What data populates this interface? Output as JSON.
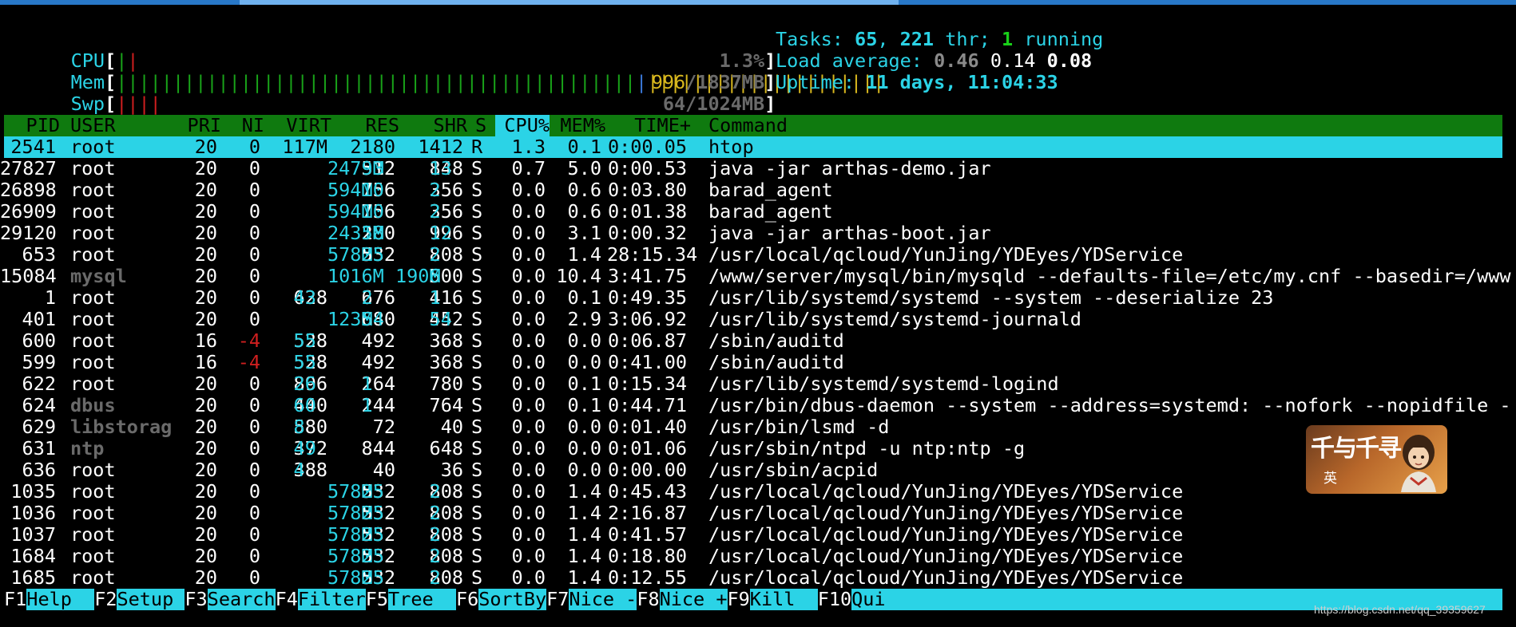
{
  "meters": {
    "cpu": {
      "label": "CPU",
      "open": "[",
      "close": "]",
      "bars": "||",
      "value": "1.3%",
      "fill_fraction": 0.013
    },
    "mem": {
      "label": "Mem",
      "open": "[",
      "close": "]",
      "bars_used": "||||||||||||||||||||||||||||||||||||||||||||||",
      "bars_buffers": "|",
      "bars_cache": "|||||||||||||||||||||",
      "value_used": "996",
      "value_rest": "/1837MB",
      "fill_fraction": 0.542
    },
    "swp": {
      "label": "Swp",
      "open": "[",
      "close": "]",
      "bars": "||||",
      "value": "64/1024MB",
      "fill_fraction": 0.0625
    }
  },
  "sysinfo": {
    "tasks_label": "Tasks: ",
    "tasks_value": "65",
    "tasks_sep": ", ",
    "threads_value": "221",
    "threads_label": " thr; ",
    "running_value": "1",
    "running_label": " running",
    "load_label": "Load average: ",
    "load_1": "0.46",
    "load_5": "0.14",
    "load_15": "0.08",
    "uptime_label": "Uptime: ",
    "uptime_value": "11 days, 11:04:33"
  },
  "columns": {
    "pid": "PID",
    "user": "USER",
    "pri": "PRI",
    "ni": "NI",
    "virt": "VIRT",
    "res": "RES",
    "shr": "SHR",
    "s": "S",
    "cpu": "CPU%",
    "mem": "MEM%",
    "time": "TIME+",
    "command": "Command"
  },
  "processes": [
    {
      "pid": "2541",
      "user": "root",
      "pri": "20",
      "ni": "0",
      "virt": "117M",
      "res": "2180",
      "shr": "1412",
      "s": "R",
      "cpu": "1.3",
      "mem": "0.1",
      "time": "0:00.05",
      "command": "htop"
    },
    {
      "pid": "27827",
      "user": "root",
      "pri": "20",
      "ni": "0",
      "virt": "2473M",
      "res": "93512",
      "shr": "13848",
      "s": "S",
      "cpu": "0.7",
      "mem": "5.0",
      "time": "0:00.53",
      "command": "java -jar arthas-demo.jar"
    },
    {
      "pid": "26898",
      "user": "root",
      "pri": "20",
      "ni": "0",
      "virt": "594M",
      "res": "10756",
      "shr": "2356",
      "s": "S",
      "cpu": "0.0",
      "mem": "0.6",
      "time": "0:03.80",
      "command": "barad_agent"
    },
    {
      "pid": "26909",
      "user": "root",
      "pri": "20",
      "ni": "0",
      "virt": "594M",
      "res": "10756",
      "shr": "2356",
      "s": "S",
      "cpu": "0.0",
      "mem": "0.6",
      "time": "0:01.38",
      "command": "barad_agent"
    },
    {
      "pid": "29120",
      "user": "root",
      "pri": "20",
      "ni": "0",
      "virt": "2431M",
      "res": "58280",
      "shr": "12996",
      "s": "S",
      "cpu": "0.0",
      "mem": "3.1",
      "time": "0:00.32",
      "command": "java -jar arthas-boot.jar"
    },
    {
      "pid": "653",
      "user": "root",
      "pri": "20",
      "ni": "0",
      "virt": "578M",
      "res": "25532",
      "shr": "2808",
      "s": "S",
      "cpu": "0.0",
      "mem": "1.4",
      "time": "28:15.34",
      "command": "/usr/local/qcloud/YunJing/YDEyes/YDService"
    },
    {
      "pid": "15084",
      "user": "mysql",
      "pri": "20",
      "ni": "0",
      "virt": "1016M",
      "res": "190M",
      "shr": "6500",
      "s": "S",
      "cpu": "0.0",
      "mem": "10.4",
      "time": "3:41.75",
      "command": "/www/server/mysql/bin/mysqld --defaults-file=/etc/my.cnf --basedir=/www"
    },
    {
      "pid": "1",
      "user": "root",
      "pri": "20",
      "ni": "0",
      "virt": "43628",
      "res": "2676",
      "shr": "1416",
      "s": "S",
      "cpu": "0.0",
      "mem": "0.1",
      "time": "0:49.35",
      "command": "/usr/lib/systemd/systemd --system --deserialize 23"
    },
    {
      "pid": "401",
      "user": "root",
      "pri": "20",
      "ni": "0",
      "virt": "123M",
      "res": "54680",
      "shr": "54452",
      "s": "S",
      "cpu": "0.0",
      "mem": "2.9",
      "time": "3:06.92",
      "command": "/usr/lib/systemd/systemd-journald"
    },
    {
      "pid": "600",
      "user": "root",
      "pri": "16",
      "ni": "-4",
      "virt": "55528",
      "res": "492",
      "shr": "368",
      "s": "S",
      "cpu": "0.0",
      "mem": "0.0",
      "time": "0:06.87",
      "command": "/sbin/auditd"
    },
    {
      "pid": "599",
      "user": "root",
      "pri": "16",
      "ni": "-4",
      "virt": "55528",
      "res": "492",
      "shr": "368",
      "s": "S",
      "cpu": "0.0",
      "mem": "0.0",
      "time": "0:41.00",
      "command": "/sbin/auditd"
    },
    {
      "pid": "622",
      "user": "root",
      "pri": "20",
      "ni": "0",
      "virt": "26896",
      "res": "1264",
      "shr": "780",
      "s": "S",
      "cpu": "0.0",
      "mem": "0.1",
      "time": "0:15.34",
      "command": "/usr/lib/systemd/systemd-logind"
    },
    {
      "pid": "624",
      "user": "dbus",
      "pri": "20",
      "ni": "0",
      "virt": "60440",
      "res": "1244",
      "shr": "764",
      "s": "S",
      "cpu": "0.0",
      "mem": "0.1",
      "time": "0:44.71",
      "command": "/usr/bin/dbus-daemon --system --address=systemd: --nofork --nopidfile -"
    },
    {
      "pid": "629",
      "user": "libstorag",
      "pri": "20",
      "ni": "0",
      "virt": "8580",
      "res": "72",
      "shr": "40",
      "s": "S",
      "cpu": "0.0",
      "mem": "0.0",
      "time": "0:01.40",
      "command": "/usr/bin/lsmd -d"
    },
    {
      "pid": "631",
      "user": "ntp",
      "pri": "20",
      "ni": "0",
      "virt": "49372",
      "res": "844",
      "shr": "648",
      "s": "S",
      "cpu": "0.0",
      "mem": "0.0",
      "time": "0:01.06",
      "command": "/usr/sbin/ntpd -u ntp:ntp -g"
    },
    {
      "pid": "636",
      "user": "root",
      "pri": "20",
      "ni": "0",
      "virt": "4388",
      "res": "40",
      "shr": "36",
      "s": "S",
      "cpu": "0.0",
      "mem": "0.0",
      "time": "0:00.00",
      "command": "/usr/sbin/acpid"
    },
    {
      "pid": "1035",
      "user": "root",
      "pri": "20",
      "ni": "0",
      "virt": "578M",
      "res": "25532",
      "shr": "2808",
      "s": "S",
      "cpu": "0.0",
      "mem": "1.4",
      "time": "0:45.43",
      "command": "/usr/local/qcloud/YunJing/YDEyes/YDService"
    },
    {
      "pid": "1036",
      "user": "root",
      "pri": "20",
      "ni": "0",
      "virt": "578M",
      "res": "25532",
      "shr": "2808",
      "s": "S",
      "cpu": "0.0",
      "mem": "1.4",
      "time": "2:16.87",
      "command": "/usr/local/qcloud/YunJing/YDEyes/YDService"
    },
    {
      "pid": "1037",
      "user": "root",
      "pri": "20",
      "ni": "0",
      "virt": "578M",
      "res": "25532",
      "shr": "2808",
      "s": "S",
      "cpu": "0.0",
      "mem": "1.4",
      "time": "0:41.57",
      "command": "/usr/local/qcloud/YunJing/YDEyes/YDService"
    },
    {
      "pid": "1684",
      "user": "root",
      "pri": "20",
      "ni": "0",
      "virt": "578M",
      "res": "25532",
      "shr": "2808",
      "s": "S",
      "cpu": "0.0",
      "mem": "1.4",
      "time": "0:18.80",
      "command": "/usr/local/qcloud/YunJing/YDEyes/YDService"
    },
    {
      "pid": "1685",
      "user": "root",
      "pri": "20",
      "ni": "0",
      "virt": "578M",
      "res": "25532",
      "shr": "2808",
      "s": "S",
      "cpu": "0.0",
      "mem": "1.4",
      "time": "0:12.55",
      "command": "/usr/local/qcloud/YunJing/YDEyes/YDService"
    }
  ],
  "footer": [
    {
      "key": "F1",
      "action": "Help  "
    },
    {
      "key": "F2",
      "action": "Setup "
    },
    {
      "key": "F3",
      "action": "Search"
    },
    {
      "key": "F4",
      "action": "Filter"
    },
    {
      "key": "F5",
      "action": "Tree  "
    },
    {
      "key": "F6",
      "action": "SortBy"
    },
    {
      "key": "F7",
      "action": "Nice -"
    },
    {
      "key": "F8",
      "action": "Nice +"
    },
    {
      "key": "F9",
      "action": "Kill  "
    },
    {
      "key": "F10",
      "action": "Quit"
    }
  ],
  "badge": {
    "title": "千与千寻",
    "subtitle": "英"
  },
  "watermark": "https://blog.csdn.net/qq_39359627",
  "colors": {
    "background": "#000000",
    "cyan": "#2bd3e6",
    "header_green": "#0f7a0f",
    "green": "#19a319",
    "red": "#d01f1f",
    "yellow": "#d9b81e",
    "blue": "#3a78d8",
    "dim_gray": "#6a6a6a"
  },
  "icons": {
    "badge_art": "girl-portrait-icon"
  }
}
